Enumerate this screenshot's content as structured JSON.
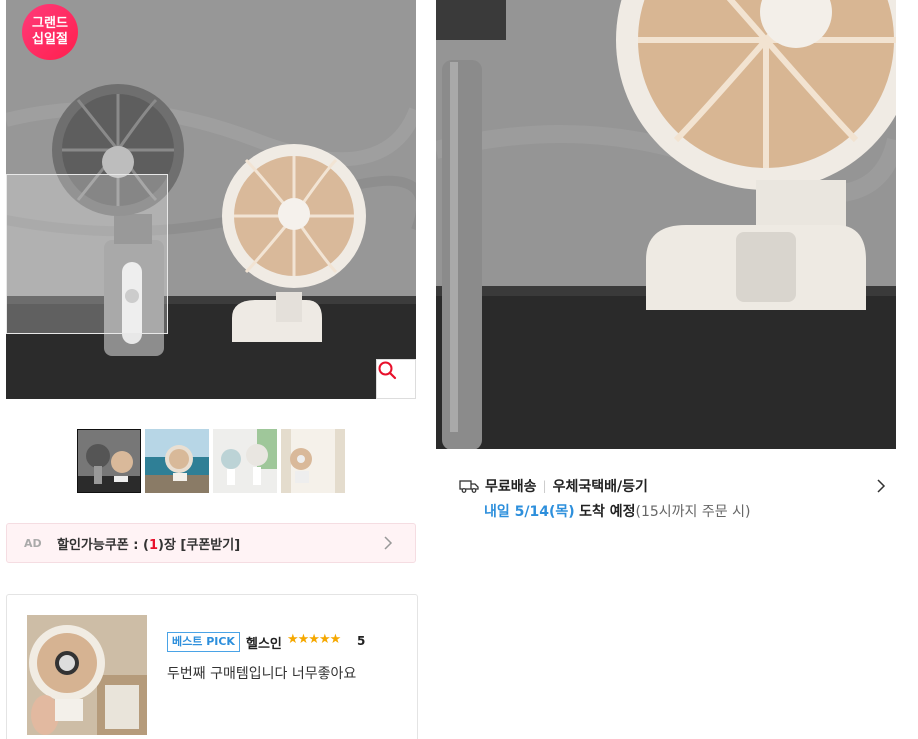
{
  "badge": {
    "text": "그랜드 십일절"
  },
  "gallery": {
    "thumbnails": [
      "fans-dark-wall",
      "fan-ocean",
      "fans-white-table",
      "fan-window"
    ],
    "selected_index": 0
  },
  "coupon": {
    "ad_label": "AD",
    "text_prefix": "할인가능쿠폰 : (",
    "count": "1",
    "text_suffix": ")장 [쿠폰받기]"
  },
  "review": {
    "badge": "베스트 PICK",
    "reviewer": "헬스인",
    "stars": "★★★★★",
    "score": "5",
    "text": "두번째 구매템입니다 너무좋아요"
  },
  "delivery": {
    "free_shipping": "무료배송",
    "carrier": "우체국택배/등기",
    "date": "내일 5/14(목)",
    "arrival": "도착 예정",
    "note": "(15시까지 주문 시)"
  },
  "colors": {
    "accent_red": "#e8102b",
    "accent_blue": "#2d8fdc",
    "badge_pink": "#ff1f4d"
  }
}
